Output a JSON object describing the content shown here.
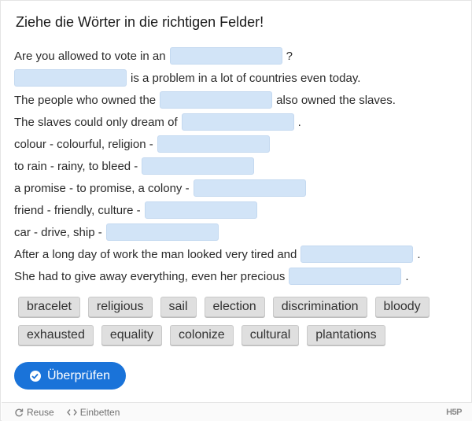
{
  "task": {
    "title": "Ziehe die Wörter in die richtigen Felder!"
  },
  "sentences": [
    {
      "before": "Are you allowed to vote in an",
      "after": "?"
    },
    {
      "before": "",
      "after": "is a problem in a lot of countries even today."
    },
    {
      "before": "The people who owned the",
      "after": "also owned the slaves."
    },
    {
      "before": "The slaves could only dream of",
      "after": "."
    },
    {
      "before": "colour - colourful, religion -",
      "after": ""
    },
    {
      "before": "to rain - rainy, to bleed -",
      "after": ""
    },
    {
      "before": "a promise - to promise, a colony -",
      "after": ""
    },
    {
      "before": "friend - friendly, culture -",
      "after": ""
    },
    {
      "before": "car - drive, ship -",
      "after": ""
    },
    {
      "before": "After a long day of work the man looked very tired and",
      "after": "."
    },
    {
      "before": "She had to give away everything, even her precious",
      "after": "."
    }
  ],
  "word_bank": {
    "row1": [
      "bracelet",
      "religious",
      "sail",
      "election",
      "discrimination",
      "bloody"
    ],
    "row2": [
      "exhausted",
      "equality",
      "colonize",
      "cultural",
      "plantations"
    ]
  },
  "buttons": {
    "check": "Überprüfen"
  },
  "footer": {
    "reuse": "Reuse",
    "embed": "Einbetten",
    "brand": "H5P"
  },
  "colors": {
    "gap_fill": "#d2e4f7",
    "button": "#1a73d9",
    "chip": "#dfdfdf"
  }
}
